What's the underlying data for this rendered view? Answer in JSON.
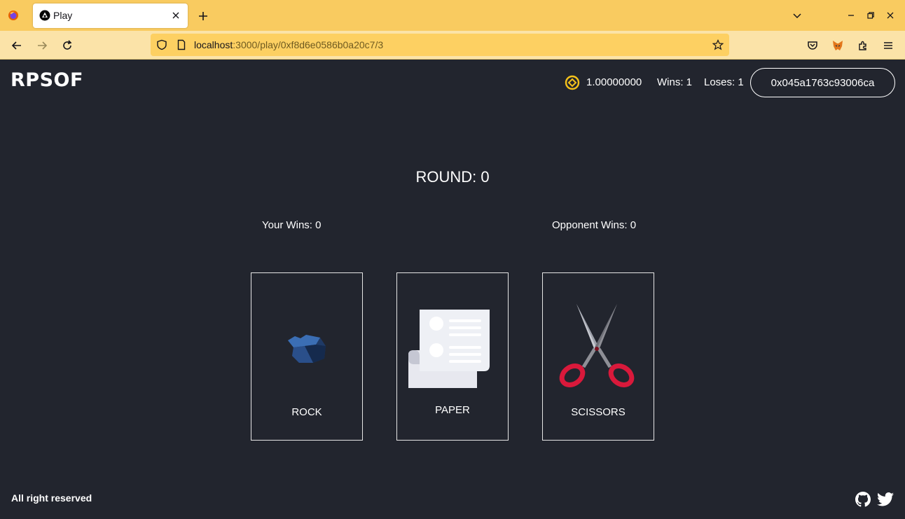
{
  "browser": {
    "tab_title": "Play",
    "url_host": "localhost",
    "url_rest": ":3000/play/0xf8d6e0586b0a20c7/3"
  },
  "header": {
    "brand": "RPSOF",
    "balance": "1.00000000",
    "wins": "Wins: 1",
    "loses": "Loses: 1",
    "wallet": "0x045a1763c93006ca"
  },
  "game": {
    "round": "ROUND: 0",
    "your_wins": "Your Wins: 0",
    "opponent_wins": "Opponent Wins: 0",
    "choices": [
      {
        "label": "ROCK",
        "icon": "rock-icon"
      },
      {
        "label": "PAPER",
        "icon": "paper-icon"
      },
      {
        "label": "SCISSORS",
        "icon": "scissors-icon"
      }
    ]
  },
  "footer": {
    "text": "All right reserved",
    "icons": [
      "github-icon",
      "twitter-icon"
    ]
  },
  "colors": {
    "background": "#22252e",
    "tabbar": "#f9cb60",
    "navbar": "#fbe3a8",
    "accent_coin": "#f4c21b"
  }
}
